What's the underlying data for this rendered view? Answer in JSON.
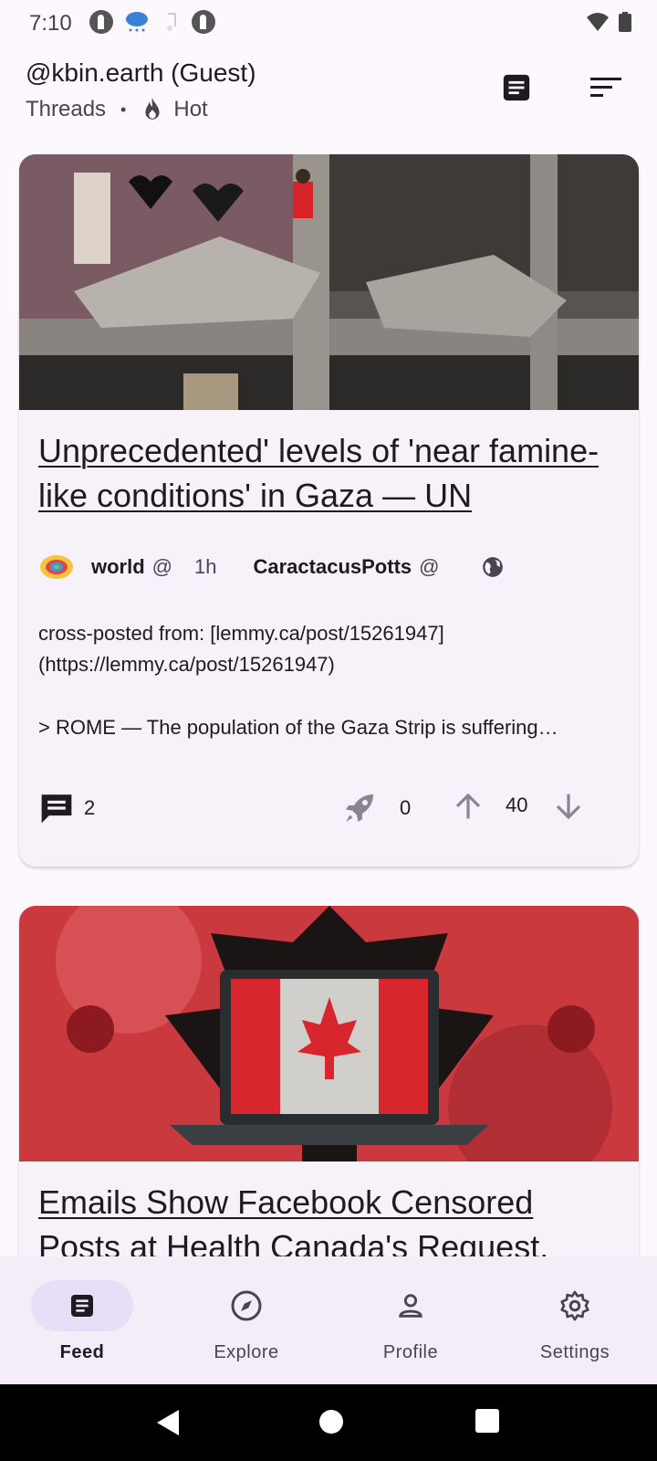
{
  "status_bar": {
    "time": "7:10"
  },
  "header": {
    "title": "@kbin.earth (Guest)",
    "feed_type": "Threads",
    "separator": "•",
    "sort": "Hot"
  },
  "posts": [
    {
      "title": "Unprecedented' levels of 'near famine-like conditions' in Gaza — UN",
      "community": "world",
      "community_at": "@",
      "age": "1h",
      "author": "CaractacusPotts",
      "author_at": "@",
      "body_line1": "cross-posted from: [lemmy.ca/post/15261947](https://lemmy.ca/post/15261947)",
      "body_line2": "> ROME — The population of the Gaza Strip is suffering…",
      "comments": "2",
      "boosts": "0",
      "score": "40"
    },
    {
      "title": "Emails Show Facebook Censored Posts at Health Canada's Request."
    }
  ],
  "nav": {
    "items": [
      {
        "label": "Feed",
        "icon": "feed-icon"
      },
      {
        "label": "Explore",
        "icon": "compass-icon"
      },
      {
        "label": "Profile",
        "icon": "person-icon"
      },
      {
        "label": "Settings",
        "icon": "gear-icon"
      }
    ]
  },
  "colors": {
    "background": "#fdf8fd",
    "card": "#f7f2fa",
    "nav_bar": "#f3edf7",
    "nav_active": "#e8def8"
  }
}
